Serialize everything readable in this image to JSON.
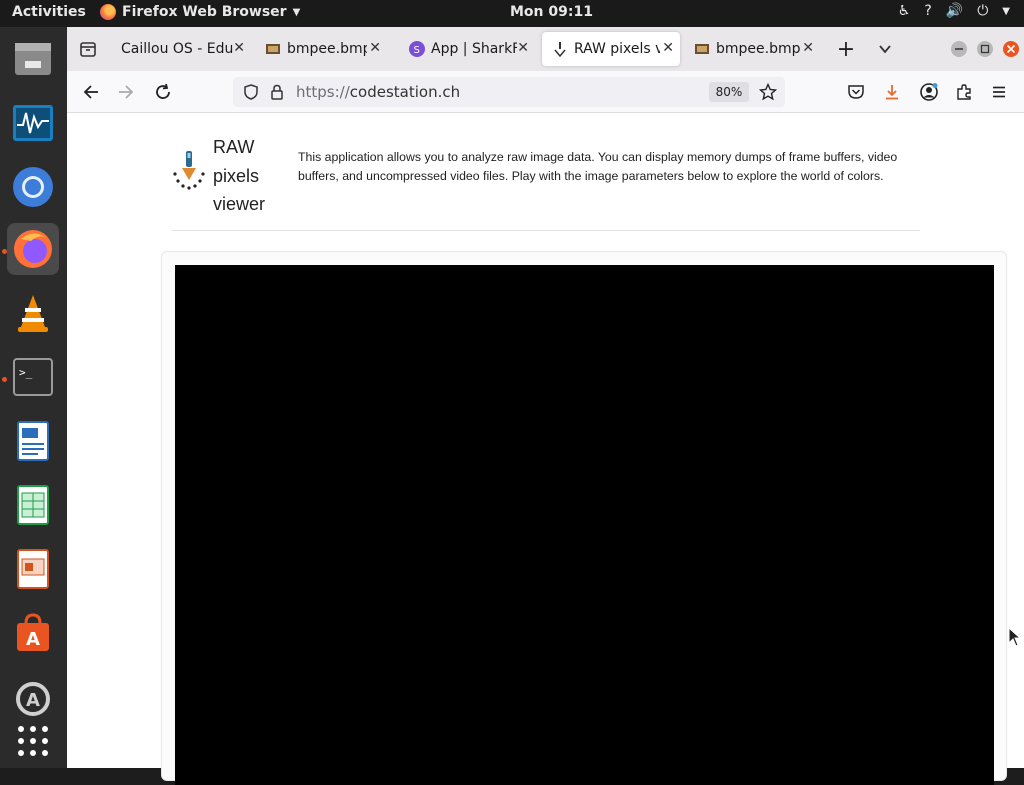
{
  "topbar": {
    "activities": "Activities",
    "app_name": "Firefox Web Browser",
    "clock": "Mon 09:11"
  },
  "dock": {
    "items": [
      "files-icon",
      "system-monitor-icon",
      "chromium-icon",
      "firefox-icon",
      "vlc-icon",
      "terminal-icon",
      "writer-icon",
      "calc-icon",
      "impress-icon",
      "software-center-icon",
      "update-icon",
      "app-grid-icon"
    ]
  },
  "browser": {
    "tabs": [
      {
        "title": "Caillou OS - Edu",
        "active": false
      },
      {
        "title": "bmpee.bmp",
        "active": false
      },
      {
        "title": "App | SharkF",
        "active": false
      },
      {
        "title": "RAW pixels v",
        "active": true
      },
      {
        "title": "bmpee.bmp",
        "active": false
      }
    ],
    "url_proto": "https://",
    "url_host": "codestation.ch",
    "zoom": "80%"
  },
  "page": {
    "title_line1": "RAW",
    "title_line2": "pixels",
    "title_line3": "viewer",
    "description": "This application allows you to analyze raw image data. You can display memory dumps of frame buffers, video buffers, and uncompressed video files. Play with the image parameters below to explore the world of colors."
  },
  "colors": {
    "accent": "#e95420",
    "topbar": "#1a1a1a",
    "dock": "#2b2b2b",
    "canvas": "#000000"
  }
}
